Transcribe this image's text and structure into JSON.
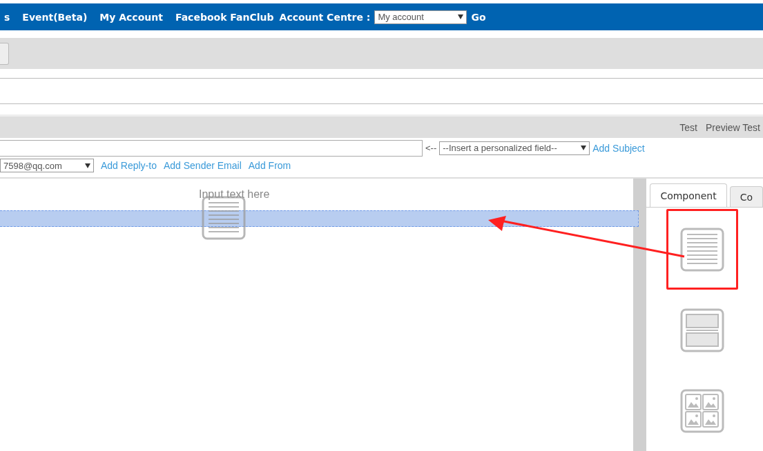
{
  "nav": {
    "items": [
      {
        "label": "s"
      },
      {
        "label": "Event(Beta)"
      },
      {
        "label": "My Account"
      },
      {
        "label": "Facebook FanClub"
      }
    ],
    "account_label": "Account Centre :",
    "account_select": "My account",
    "go": "Go"
  },
  "toolbar": {
    "links": [
      "Test",
      "Preview Test"
    ]
  },
  "subject_row": {
    "arrow": "<--",
    "insert_select": "--Insert a personalized field--",
    "link": "Add Subject"
  },
  "sender_row": {
    "sender_select": "7598@qq.com",
    "links": [
      "Add Reply-to",
      "Add Sender Email",
      "Add From"
    ]
  },
  "editor": {
    "drag_text": "Input text here"
  },
  "panel": {
    "tabs": [
      {
        "label": "Component",
        "selected": true
      },
      {
        "label": "Co",
        "selected": false
      }
    ],
    "components": [
      {
        "kind": "text",
        "highlighted": true
      },
      {
        "kind": "boxes",
        "highlighted": false
      },
      {
        "kind": "images",
        "highlighted": false
      }
    ]
  }
}
